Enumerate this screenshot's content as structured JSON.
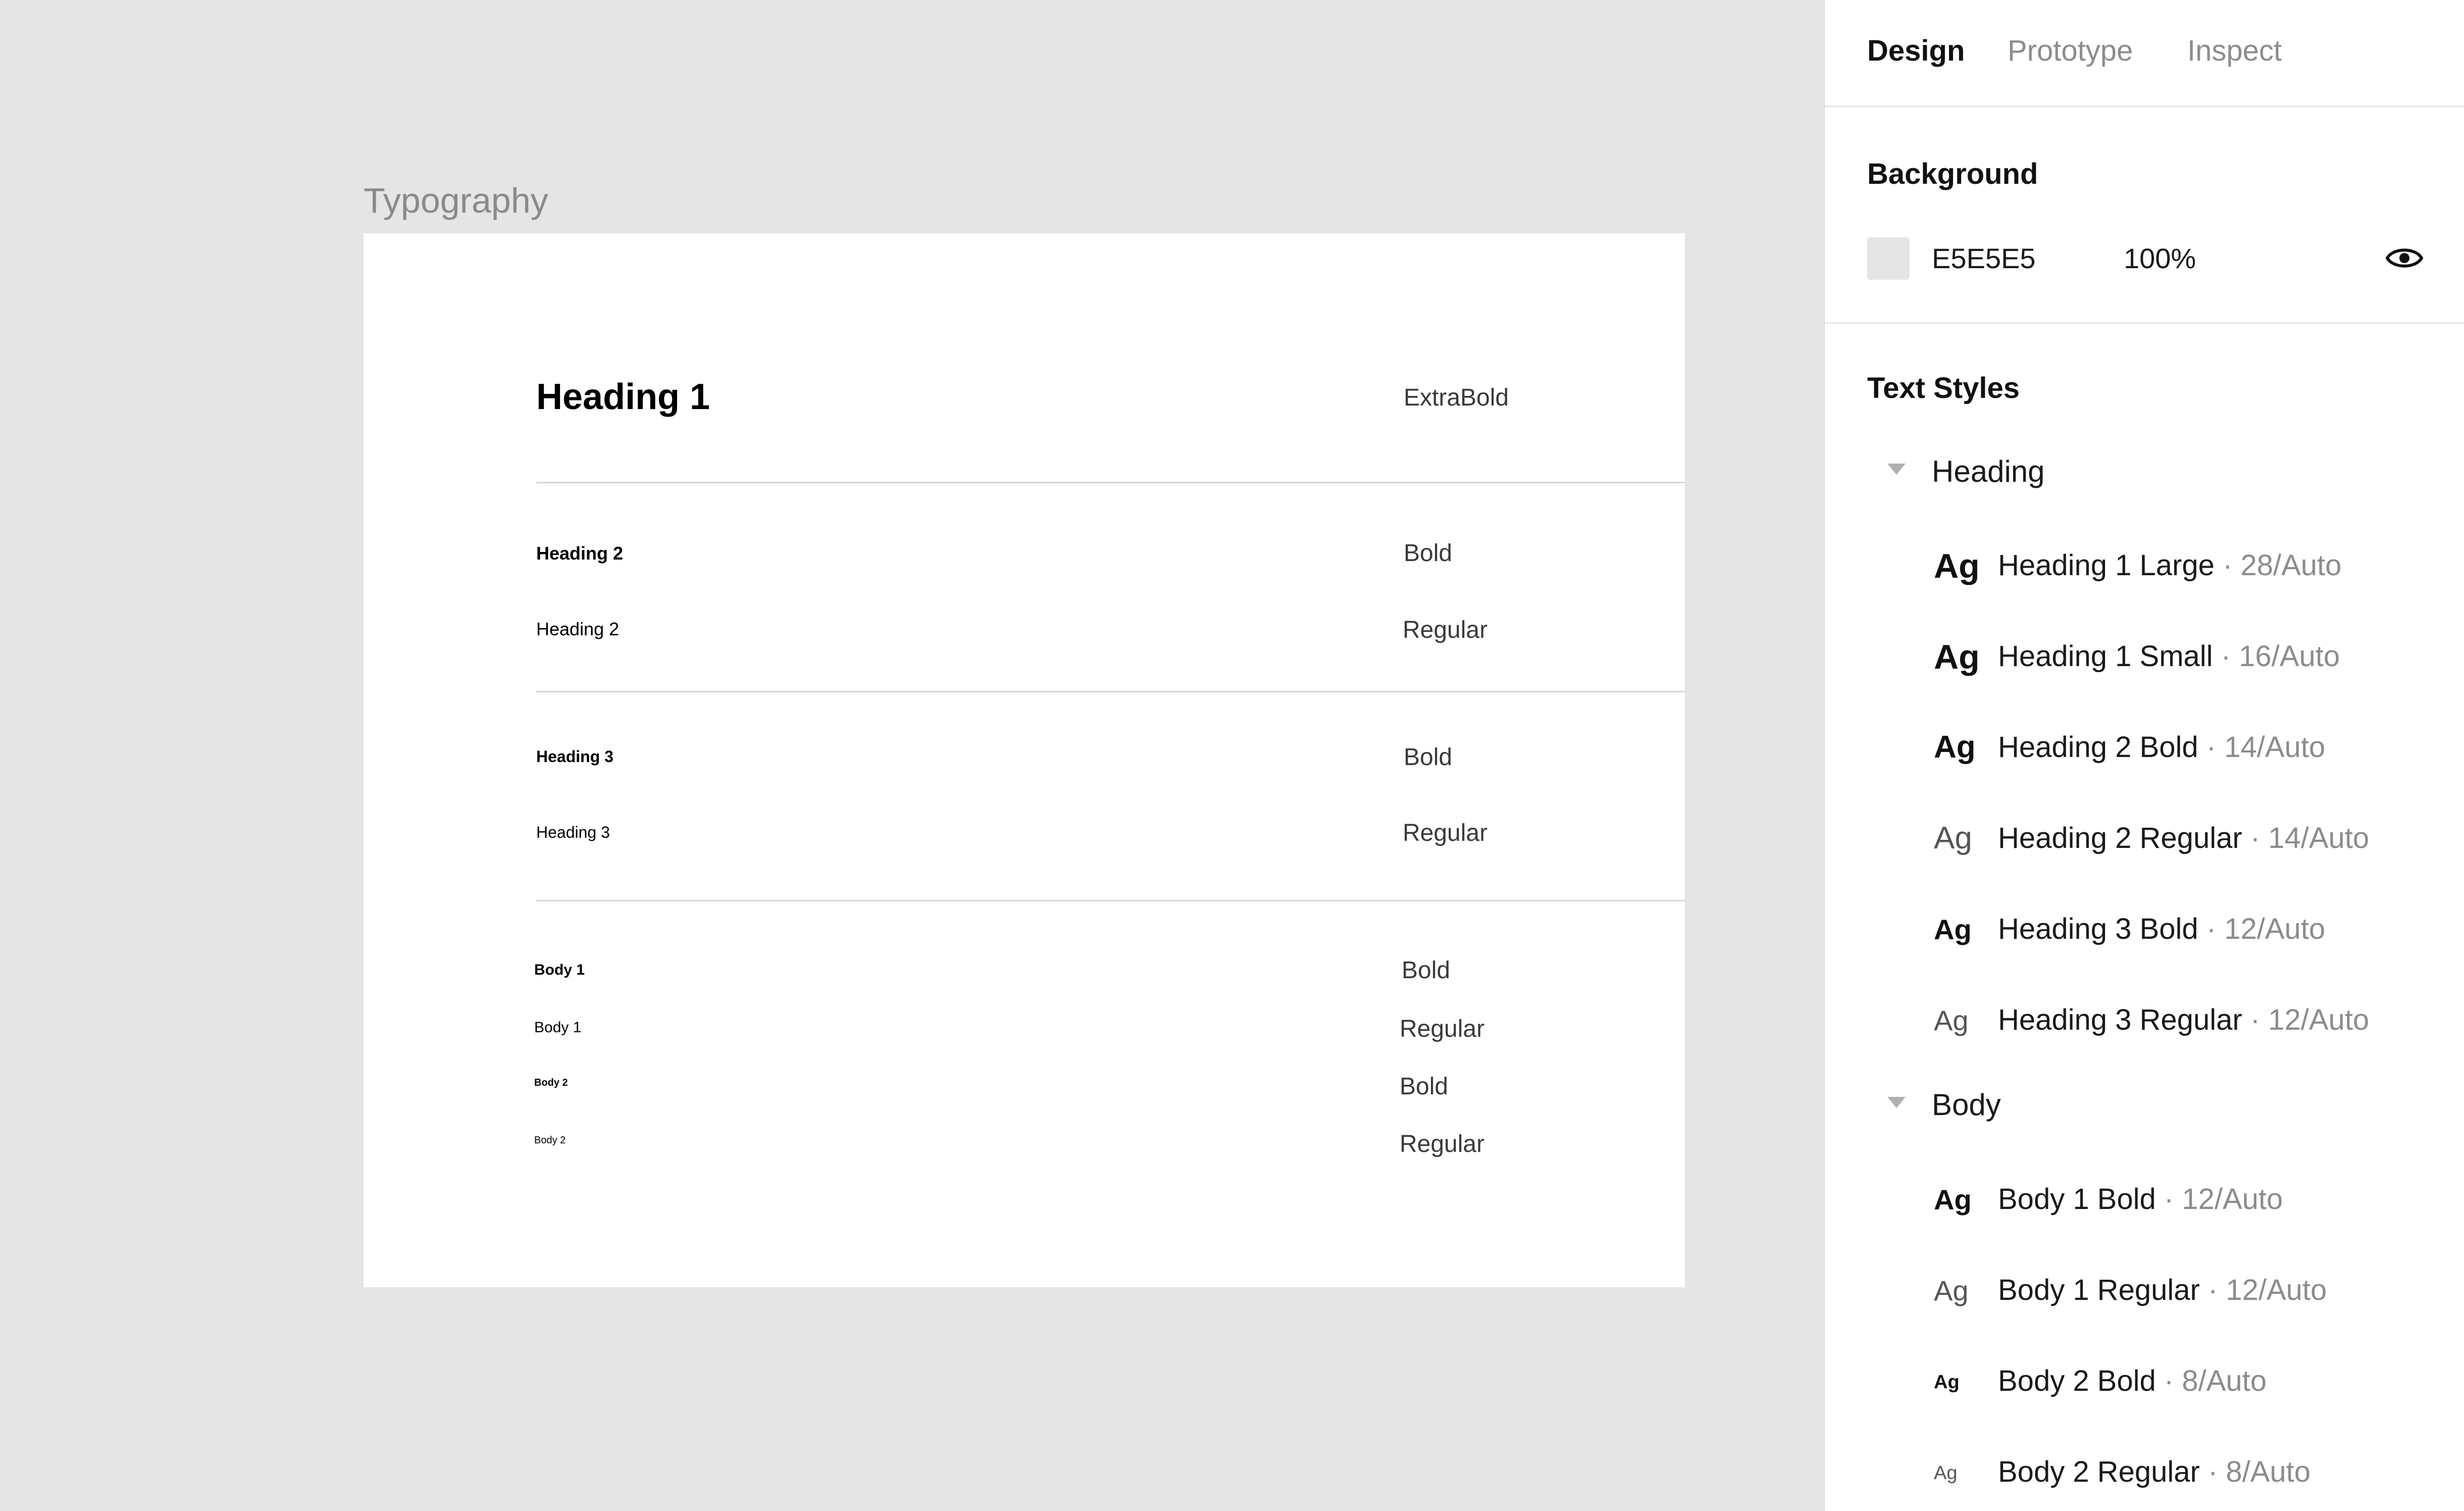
{
  "canvas": {
    "background": "#E5E5E5",
    "frame_label": "Typography",
    "rows": [
      {
        "name": "Heading 1",
        "weight": "ExtraBold"
      },
      {
        "name": "Heading 2",
        "weight": "Bold"
      },
      {
        "name": "Heading 2",
        "weight": "Regular"
      },
      {
        "name": "Heading 3",
        "weight": "Bold"
      },
      {
        "name": "Heading 3",
        "weight": "Regular"
      },
      {
        "name": "Body 1",
        "weight": "Bold"
      },
      {
        "name": "Body 1",
        "weight": "Regular"
      },
      {
        "name": "Body 2",
        "weight": "Bold"
      },
      {
        "name": "Body 2",
        "weight": "Regular"
      }
    ]
  },
  "panel": {
    "tabs": [
      {
        "label": "Design",
        "active": true
      },
      {
        "label": "Prototype",
        "active": false
      },
      {
        "label": "Inspect",
        "active": false
      }
    ],
    "background": {
      "title": "Background",
      "hex": "E5E5E5",
      "opacity": "100%",
      "swatch_color": "#E5E5E5",
      "visibility_icon": "eye-icon"
    },
    "text_styles": {
      "title": "Text Styles",
      "groups": [
        {
          "label": "Heading",
          "items": [
            {
              "preview": "Ag",
              "name": "Heading 1 Large",
              "meta": "· 28/Auto"
            },
            {
              "preview": "Ag",
              "name": "Heading 1 Small",
              "meta": "· 16/Auto"
            },
            {
              "preview": "Ag",
              "name": "Heading 2 Bold",
              "meta": "· 14/Auto"
            },
            {
              "preview": "Ag",
              "name": "Heading 2 Regular",
              "meta": "· 14/Auto"
            },
            {
              "preview": "Ag",
              "name": "Heading 3 Bold",
              "meta": "· 12/Auto"
            },
            {
              "preview": "Ag",
              "name": "Heading 3 Regular",
              "meta": "· 12/Auto"
            }
          ]
        },
        {
          "label": "Body",
          "items": [
            {
              "preview": "Ag",
              "name": "Body 1 Bold",
              "meta": "· 12/Auto"
            },
            {
              "preview": "Ag",
              "name": "Body 1 Regular",
              "meta": "· 12/Auto"
            },
            {
              "preview": "Ag",
              "name": "Body 2 Bold",
              "meta": "· 8/Auto"
            },
            {
              "preview": "Ag",
              "name": "Body 2 Regular",
              "meta": "· 8/Auto"
            }
          ]
        }
      ]
    }
  }
}
